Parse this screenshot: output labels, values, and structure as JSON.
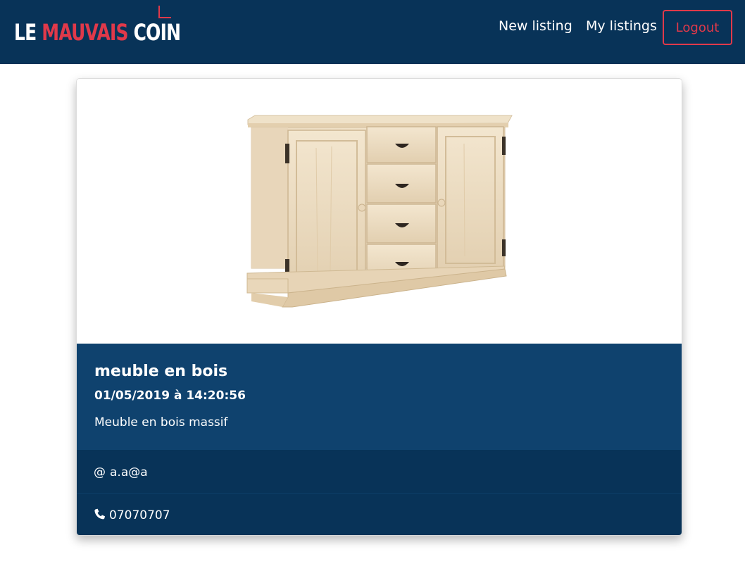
{
  "navbar": {
    "brand": {
      "word1": "LE ",
      "word2": "MAUVAIS",
      "word3": " COIN"
    },
    "links": [
      {
        "label": "New listing"
      },
      {
        "label": "My listings"
      }
    ],
    "logout_label": "Logout"
  },
  "listing": {
    "image_subject": "wooden sideboard",
    "title": "meuble en bois",
    "date": "01/05/2019 à 14:20:56",
    "description": "Meuble en bois massif",
    "email_icon": "@",
    "email": "a.a@a",
    "phone_icon": "phone-icon",
    "phone": "07070707"
  },
  "colors": {
    "navbar_bg": "#083358",
    "card_body_bg": "#0f426e",
    "accent": "#e0394a"
  }
}
